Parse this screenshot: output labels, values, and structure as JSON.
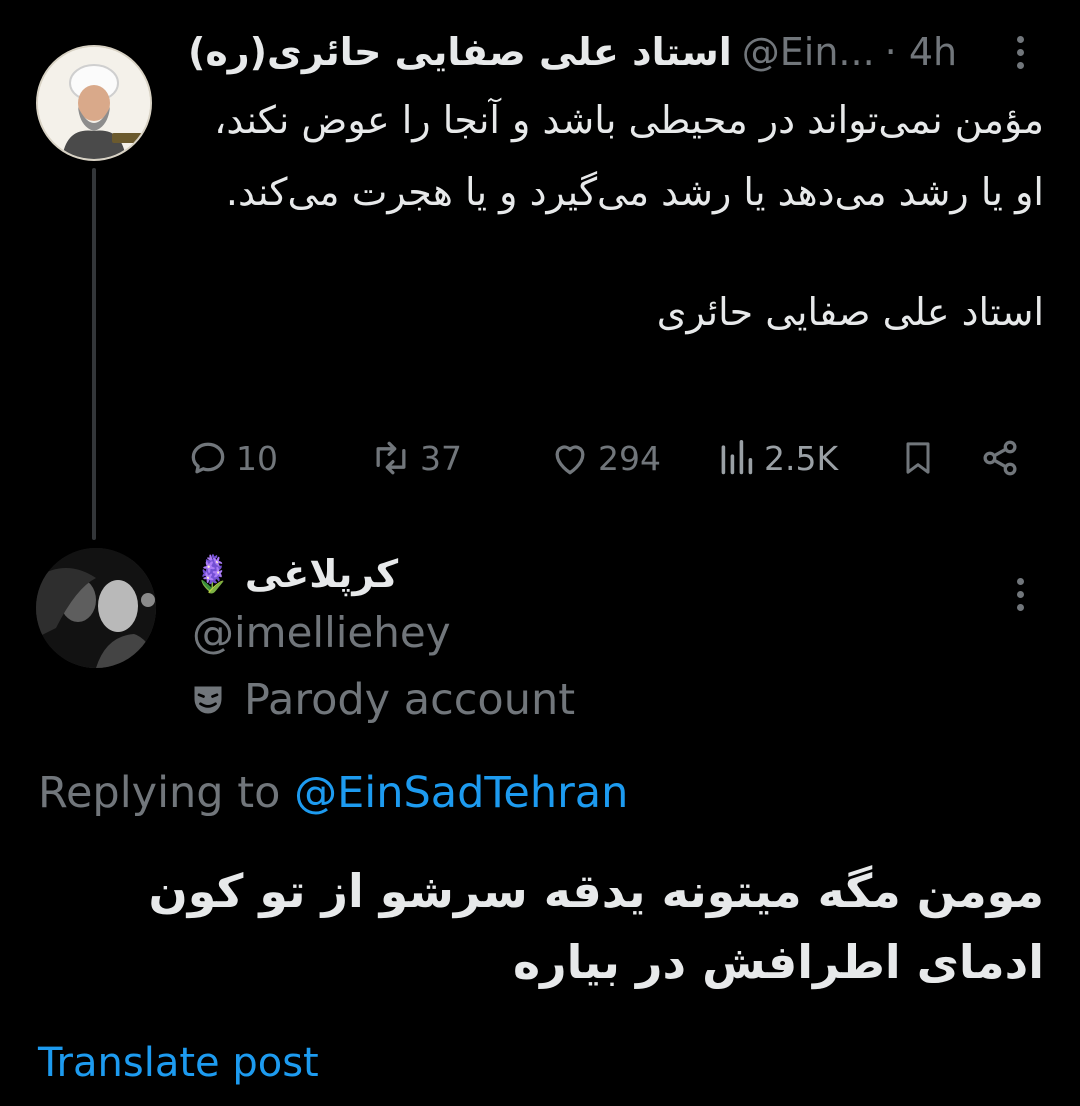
{
  "parent_tweet": {
    "author_name": "استاد علی صفایی حائری(ره)",
    "handle": "@Ein...",
    "time": "· 4h",
    "avatar_icon": "profile-photo-cleric-icon",
    "body_paragraphs": [
      "مؤمن نمی‌تواند در محیطی باشد و آنجا را عوض نکند، او یا رشد می‌دهد یا رشد می‌گیرد و یا هجرت می‌کند.",
      "استاد علی صفایی حائری"
    ],
    "actions": {
      "replies": "10",
      "retweets": "37",
      "likes": "294",
      "views": "2.5K"
    }
  },
  "reply_tweet": {
    "author_name": "کرپلاغی",
    "name_emoji": "🪻",
    "handle": "@imelliehey",
    "parody_label": "Parody account",
    "replying_prefix": "Replying to",
    "replying_to": "@EinSadTehran",
    "body": "مومن مگه میتونه یدقه سرشو از تو کون ادمای اطرافش در بیاره",
    "translate_label": "Translate post"
  },
  "colors": {
    "background": "#000000",
    "text_primary": "#e7e9ea",
    "text_secondary": "#71767b",
    "accent": "#1d9bf0"
  }
}
